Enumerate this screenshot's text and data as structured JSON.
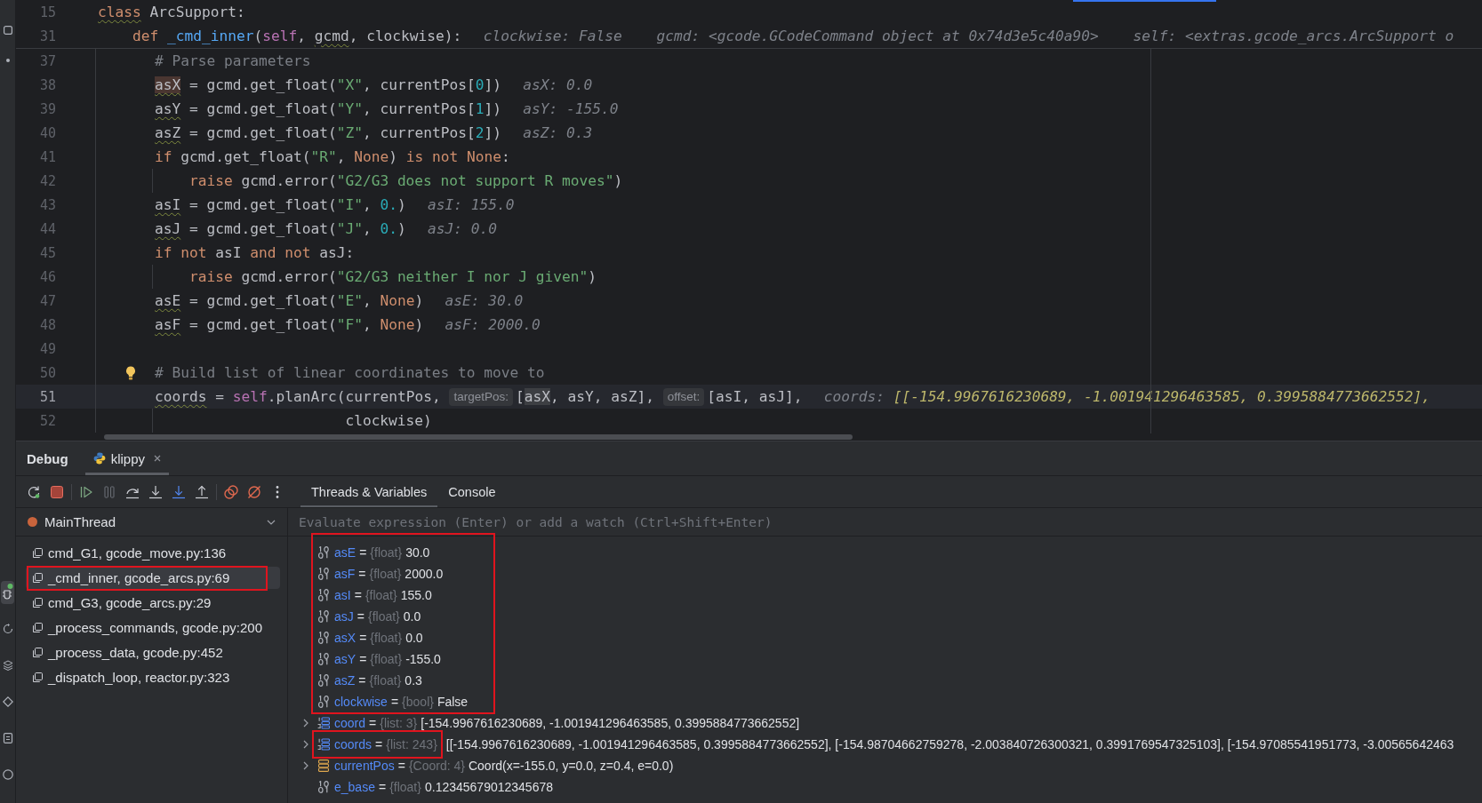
{
  "editor": {
    "sticky_lines": [
      {
        "number": "15",
        "tokens": [
          {
            "kind": "weak_keyword",
            "text": "class"
          },
          {
            "kind": "text",
            "text": " ArcSupport:"
          }
        ],
        "children": [
          {
            "number": "31",
            "tokens": [
              {
                "kind": "keyword",
                "text": "def"
              },
              {
                "kind": "function",
                "text": " _cmd_inner"
              },
              {
                "kind": "text",
                "text": "("
              },
              {
                "kind": "self",
                "text": "self"
              },
              {
                "kind": "text",
                "text": ", "
              },
              {
                "kind": "weak",
                "text": "gcmd"
              },
              {
                "kind": "text",
                "text": ", clockwise):"
              },
              {
                "kind": "value",
                "text": "clockwise: False"
              },
              {
                "kind": "value",
                "text": "gcmd: <gcode.GCodeCommand object at 0x74d3e5c40a90>"
              },
              {
                "kind": "value",
                "text": "self: <extras.gcode_arcs.ArcSupport o"
              }
            ]
          }
        ]
      }
    ],
    "lines": [
      {
        "number": "37",
        "current": false,
        "bulb": false,
        "tokens": [
          {
            "kind": "comment",
            "text": "# Parse parameters"
          }
        ]
      },
      {
        "number": "38",
        "current": false,
        "bulb": false,
        "tokens": [
          {
            "kind": "write_usage",
            "text": "asX"
          },
          {
            "kind": "text",
            "text": " = gcmd.get_float("
          },
          {
            "kind": "string",
            "text": "\"X\""
          },
          {
            "kind": "text",
            "text": ", currentPos["
          },
          {
            "kind": "number",
            "text": "0"
          },
          {
            "kind": "text",
            "text": "])"
          },
          {
            "kind": "value",
            "text": "asX: 0.0"
          }
        ]
      },
      {
        "number": "39",
        "current": false,
        "bulb": false,
        "tokens": [
          {
            "kind": "weak",
            "text": "asY"
          },
          {
            "kind": "text",
            "text": " = gcmd.get_float("
          },
          {
            "kind": "string",
            "text": "\"Y\""
          },
          {
            "kind": "text",
            "text": ", currentPos["
          },
          {
            "kind": "number",
            "text": "1"
          },
          {
            "kind": "text",
            "text": "])"
          },
          {
            "kind": "value",
            "text": "asY: -155.0"
          }
        ]
      },
      {
        "number": "40",
        "current": false,
        "bulb": false,
        "tokens": [
          {
            "kind": "weak",
            "text": "asZ"
          },
          {
            "kind": "text",
            "text": " = gcmd.get_float("
          },
          {
            "kind": "string",
            "text": "\"Z\""
          },
          {
            "kind": "text",
            "text": ", currentPos["
          },
          {
            "kind": "number",
            "text": "2"
          },
          {
            "kind": "text",
            "text": "])"
          },
          {
            "kind": "value",
            "text": "asZ: 0.3"
          }
        ]
      },
      {
        "number": "41",
        "current": false,
        "bulb": false,
        "tokens": [
          {
            "kind": "keyword",
            "text": "if"
          },
          {
            "kind": "text",
            "text": " gcmd.get_float("
          },
          {
            "kind": "string",
            "text": "\"R\""
          },
          {
            "kind": "text",
            "text": ", "
          },
          {
            "kind": "keyword",
            "text": "None"
          },
          {
            "kind": "text",
            "text": ") "
          },
          {
            "kind": "keyword",
            "text": "is not None"
          },
          {
            "kind": "text",
            "text": ":"
          }
        ],
        "children": [
          {
            "number": "42",
            "current": false,
            "bulb": false,
            "tokens": [
              {
                "kind": "keyword",
                "text": "raise"
              },
              {
                "kind": "text",
                "text": " gcmd.error("
              },
              {
                "kind": "string",
                "text": "\"G2/G3 does not support R moves\""
              },
              {
                "kind": "text",
                "text": ")"
              }
            ]
          }
        ]
      },
      {
        "number": "43",
        "current": false,
        "bulb": false,
        "tokens": [
          {
            "kind": "weak",
            "text": "asI"
          },
          {
            "kind": "text",
            "text": " = gcmd.get_float("
          },
          {
            "kind": "string",
            "text": "\"I\""
          },
          {
            "kind": "text",
            "text": ", "
          },
          {
            "kind": "number",
            "text": "0."
          },
          {
            "kind": "text",
            "text": ")"
          },
          {
            "kind": "value",
            "text": "asI: 155.0"
          }
        ]
      },
      {
        "number": "44",
        "current": false,
        "bulb": false,
        "tokens": [
          {
            "kind": "weak",
            "text": "asJ"
          },
          {
            "kind": "text",
            "text": " = gcmd.get_float("
          },
          {
            "kind": "string",
            "text": "\"J\""
          },
          {
            "kind": "text",
            "text": ", "
          },
          {
            "kind": "number",
            "text": "0."
          },
          {
            "kind": "text",
            "text": ")"
          },
          {
            "kind": "value",
            "text": "asJ: 0.0"
          }
        ]
      },
      {
        "number": "45",
        "current": false,
        "bulb": false,
        "tokens": [
          {
            "kind": "keyword",
            "text": "if not"
          },
          {
            "kind": "text",
            "text": " asI "
          },
          {
            "kind": "keyword",
            "text": "and not"
          },
          {
            "kind": "text",
            "text": " asJ:"
          }
        ],
        "children": [
          {
            "number": "46",
            "current": false,
            "bulb": false,
            "tokens": [
              {
                "kind": "keyword",
                "text": "raise"
              },
              {
                "kind": "text",
                "text": " gcmd.error("
              },
              {
                "kind": "string",
                "text": "\"G2/G3 neither I nor J given\""
              },
              {
                "kind": "text",
                "text": ")"
              }
            ]
          }
        ]
      },
      {
        "number": "47",
        "current": false,
        "bulb": false,
        "tokens": [
          {
            "kind": "weak",
            "text": "asE"
          },
          {
            "kind": "text",
            "text": " = gcmd.get_float("
          },
          {
            "kind": "string",
            "text": "\"E\""
          },
          {
            "kind": "text",
            "text": ", "
          },
          {
            "kind": "keyword",
            "text": "None"
          },
          {
            "kind": "text",
            "text": ")"
          },
          {
            "kind": "value",
            "text": "asE: 30.0"
          }
        ]
      },
      {
        "number": "48",
        "current": false,
        "bulb": false,
        "tokens": [
          {
            "kind": "weak",
            "text": "asF"
          },
          {
            "kind": "text",
            "text": " = gcmd.get_float("
          },
          {
            "kind": "string",
            "text": "\"F\""
          },
          {
            "kind": "text",
            "text": ", "
          },
          {
            "kind": "keyword",
            "text": "None"
          },
          {
            "kind": "text",
            "text": ")"
          },
          {
            "kind": "value",
            "text": "asF: 2000.0"
          }
        ]
      },
      {
        "number": "49",
        "current": false,
        "bulb": false
      },
      {
        "number": "50",
        "current": false,
        "bulb": true,
        "tokens": [
          {
            "kind": "comment",
            "text": "# Build list of linear coordinates to move to"
          }
        ]
      },
      {
        "number": "51",
        "current": true,
        "bulb": false,
        "tokens": [
          {
            "kind": "weak",
            "text": "coords"
          },
          {
            "kind": "text",
            "text": " = "
          },
          {
            "kind": "self",
            "text": "self"
          },
          {
            "kind": "text",
            "text": ".planArc(currentPos, "
          },
          {
            "kind": "hint",
            "text": "targetPos:"
          },
          {
            "kind": "text",
            "text": "["
          },
          {
            "kind": "read_usage",
            "text": "asX"
          },
          {
            "kind": "text",
            "text": ", asY, asZ], "
          },
          {
            "kind": "hint",
            "text": "offset:"
          },
          {
            "kind": "text",
            "text": "[asI, asJ],"
          },
          {
            "kind": "changed_value",
            "label": "coords:",
            "text": "[[-154.9967616230689, -1.001941296463585, 0.3995884773662552],"
          }
        ],
        "continuation": {
          "number": "52",
          "current": false,
          "bulb": false,
          "tokens": [
            {
              "kind": "text",
              "text": "clockwise)"
            }
          ]
        }
      }
    ]
  },
  "debug": {
    "title": "Debug",
    "session_tabs": [
      {
        "label": "klippy",
        "selected": true
      }
    ],
    "view_tabs": [
      {
        "label": "Threads & Variables",
        "selected": true
      },
      {
        "label": "Console",
        "selected": false
      }
    ],
    "thread": {
      "name": "MainThread"
    },
    "frames": [
      {
        "label": "cmd_G1, gcode_move.py:136",
        "selected": false,
        "boxed": false
      },
      {
        "label": "_cmd_inner, gcode_arcs.py:69",
        "selected": true,
        "boxed": true
      },
      {
        "label": "cmd_G3, gcode_arcs.py:29",
        "selected": false,
        "boxed": false
      },
      {
        "label": "_process_commands, gcode.py:200",
        "selected": false,
        "boxed": false
      },
      {
        "label": "_process_data, gcode.py:452",
        "selected": false,
        "boxed": false
      },
      {
        "label": "_dispatch_loop, reactor.py:323",
        "selected": false,
        "boxed": false
      }
    ],
    "evaluate": {
      "placeholder": "Evaluate expression (Enter) or add a watch (Ctrl+Shift+Enter)"
    },
    "variable_groups": [
      {
        "boxed": true,
        "variables": [
          {
            "kind": "primitive",
            "name": "asE",
            "equals": "=",
            "type": "{float}",
            "value": "30.0",
            "expandable": false
          },
          {
            "kind": "primitive",
            "name": "asF",
            "equals": "=",
            "type": "{float}",
            "value": "2000.0",
            "expandable": false
          },
          {
            "kind": "primitive",
            "name": "asI",
            "equals": "=",
            "type": "{float}",
            "value": "155.0",
            "expandable": false
          },
          {
            "kind": "primitive",
            "name": "asJ",
            "equals": "=",
            "type": "{float}",
            "value": "0.0",
            "expandable": false
          },
          {
            "kind": "primitive",
            "name": "asX",
            "equals": "=",
            "type": "{float}",
            "value": "0.0",
            "expandable": false
          },
          {
            "kind": "primitive",
            "name": "asY",
            "equals": "=",
            "type": "{float}",
            "value": "-155.0",
            "expandable": false
          },
          {
            "kind": "primitive",
            "name": "asZ",
            "equals": "=",
            "type": "{float}",
            "value": "0.3",
            "expandable": false
          },
          {
            "kind": "primitive",
            "name": "clockwise",
            "equals": "=",
            "type": "{bool}",
            "value": "False",
            "expandable": false
          }
        ]
      },
      {
        "boxed": false,
        "variables": [
          {
            "kind": "list",
            "name": "coord",
            "equals": "=",
            "type": "{list: 3}",
            "value": "[-154.9967616230689, -1.001941296463585, 0.3995884773662552]",
            "expandable": true
          }
        ]
      },
      {
        "boxed": true,
        "variables": [
          {
            "kind": "list",
            "name": "coords",
            "equals": "=",
            "type": "{list: 243}",
            "value": "[[-154.9967616230689, -1.001941296463585, 0.3995884773662552], [-154.98704662759278, -2.003840726300321, 0.3991769547325103], [-154.97085541951773, -3.00565642463",
            "expandable": true
          }
        ]
      },
      {
        "boxed": false,
        "variables": [
          {
            "kind": "object",
            "name": "currentPos",
            "equals": "=",
            "type": "{Coord: 4}",
            "value": "Coord(x=-155.0, y=0.0, z=0.4, e=0.0)",
            "expandable": true
          },
          {
            "kind": "primitive",
            "name": "e_base",
            "equals": "=",
            "type": "{float}",
            "value": "0.12345679012345678",
            "expandable": false
          }
        ]
      }
    ]
  }
}
